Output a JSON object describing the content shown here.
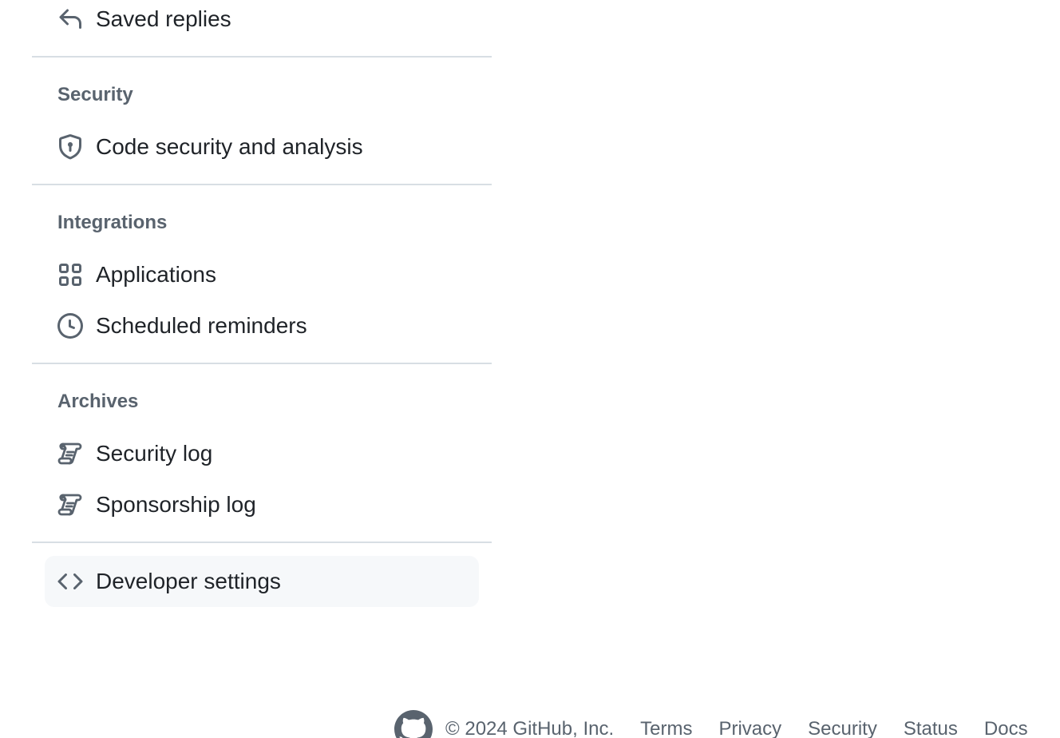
{
  "sidebar": {
    "top_item": {
      "label": "Saved replies",
      "icon": "reply-icon"
    },
    "groups": [
      {
        "heading": "Security",
        "items": [
          {
            "label": "Code security and analysis",
            "icon": "shield-lock-icon"
          }
        ]
      },
      {
        "heading": "Integrations",
        "items": [
          {
            "label": "Applications",
            "icon": "apps-grid-icon"
          },
          {
            "label": "Scheduled reminders",
            "icon": "clock-icon"
          }
        ]
      },
      {
        "heading": "Archives",
        "items": [
          {
            "label": "Security log",
            "icon": "log-scroll-icon"
          },
          {
            "label": "Sponsorship log",
            "icon": "log-scroll-icon"
          }
        ]
      }
    ],
    "developer_settings": {
      "label": "Developer settings",
      "icon": "code-icon"
    }
  },
  "footer": {
    "logo_icon": "github-mark-icon",
    "copyright": "© 2024 GitHub, Inc.",
    "links": [
      "Terms",
      "Privacy",
      "Security",
      "Status",
      "Docs"
    ]
  },
  "colors": {
    "text_primary": "#1f2328",
    "text_muted": "#59636e",
    "divider": "#d8dee4",
    "active_bg": "#f6f8fa"
  }
}
